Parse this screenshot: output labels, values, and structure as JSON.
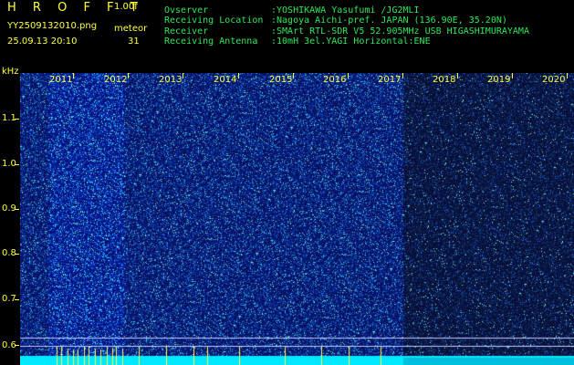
{
  "header": {
    "title": "H R O F F T",
    "version": "1.00f",
    "filename": "YY2509132010.png",
    "datetime": "25.09.13 20:10",
    "meteor_label": "meteor",
    "meteor_count": "31",
    "info": [
      {
        "key": "Ovserver",
        "value": ":YOSHIKAWA Yasufumi /JG2MLI"
      },
      {
        "key": "Receiving Location",
        "value": ":Nagoya Aichi-pref. JAPAN (136.90E, 35.20N)"
      },
      {
        "key": "Receiver",
        "value": ":SMArt RTL-SDR V5 52.905MHz USB HIGASHIMURAYAMA"
      },
      {
        "key": "Receiving Antenna",
        "value": ":10mH 3el.YAGI Horizontal:ENE"
      }
    ]
  },
  "axis": {
    "unit": "kHz",
    "ticks": [
      "1.1",
      "1.0",
      "0.9",
      "0.8",
      "0.7",
      "0.6"
    ]
  },
  "years": [
    "2011",
    "2012",
    "2013",
    "2014",
    "2015",
    "2016",
    "2017",
    "2018",
    "2019",
    "2020"
  ],
  "colors": {
    "text": "#ffff3a",
    "green": "#2ee85a",
    "bg": "#000000"
  }
}
